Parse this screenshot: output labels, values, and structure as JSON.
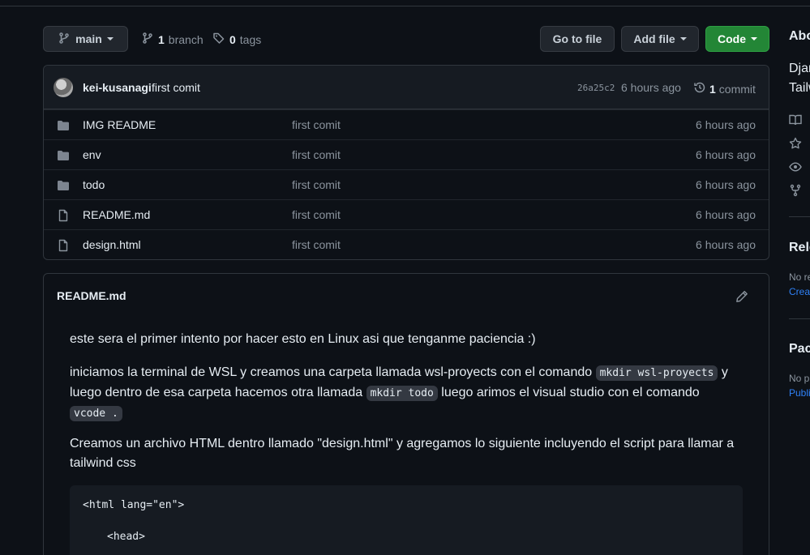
{
  "toolbar": {
    "branch_select": "main",
    "branches_count": "1",
    "branches_label": "branch",
    "tags_count": "0",
    "tags_label": "tags",
    "go_to_file": "Go to file",
    "add_file": "Add file",
    "code": "Code"
  },
  "commit": {
    "author": "kei-kusanagi",
    "message": "first comit",
    "hash": "26a25c2",
    "time": "6 hours ago",
    "count": "1",
    "count_label": "commit"
  },
  "files": [
    {
      "type": "folder",
      "name": "IMG README",
      "message": "first comit",
      "age": "6 hours ago"
    },
    {
      "type": "folder",
      "name": "env",
      "message": "first comit",
      "age": "6 hours ago"
    },
    {
      "type": "folder",
      "name": "todo",
      "message": "first comit",
      "age": "6 hours ago"
    },
    {
      "type": "file",
      "name": "README.md",
      "message": "first comit",
      "age": "6 hours ago"
    },
    {
      "type": "file",
      "name": "design.html",
      "message": "first comit",
      "age": "6 hours ago"
    }
  ],
  "readme": {
    "title": "README.md",
    "p1": "este sera el primer intento por hacer esto en Linux asi que tenganme paciencia :)",
    "p2_a": "iniciamos la terminal de WSL y creamos una carpeta llamada wsl-proyects con el comando ",
    "p2_code1": "mkdir wsl-proyects",
    "p2_b": " y luego dentro de esa carpeta hacemos otra llamada ",
    "p2_code2": "mkdir todo",
    "p2_c": " luego arimos el visual studio con el comando ",
    "p2_code3": "vcode .",
    "p3": "Creamos un archivo HTML dentro llamado \"design.html\" y agregamos lo siguiente incluyendo el script para llamar a tailwind css",
    "code_line1": "<html lang=\"en\">",
    "code_line2": "<head>"
  },
  "sidebar": {
    "about": "Abo",
    "desc1": "Djan",
    "desc2": "Tailw",
    "releases": "Rele",
    "releases_text": "No re",
    "releases_link": "Creat",
    "packages": "Pac",
    "packages_text": "No p",
    "packages_link": "Publi"
  },
  "colors": {
    "background": "#0d1117",
    "border": "#30363d",
    "muted_text": "#8b949e",
    "green_button": "#238636",
    "link": "#2f81f7"
  }
}
